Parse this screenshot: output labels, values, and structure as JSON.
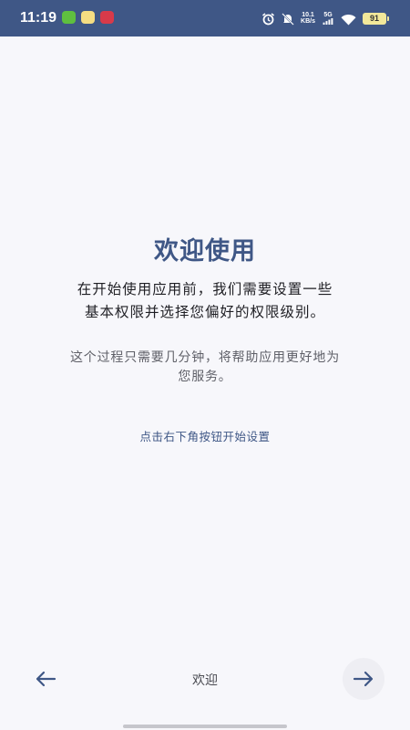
{
  "status_bar": {
    "time": "11:19",
    "net_speed_value": "10.1",
    "net_speed_unit": "KB/s",
    "network_gen": "5G",
    "battery": "91",
    "bg_color": "#3f5786",
    "app_icons": [
      "wechat-app-icon",
      "yellow-app-icon",
      "red-app-icon"
    ],
    "icons": [
      "alarm-icon",
      "mute-icon",
      "signal-icon",
      "wifi-icon",
      "battery-icon"
    ]
  },
  "main": {
    "title": "欢迎使用",
    "intro_lines": [
      "在开始使用应用前，我们需要设置一些",
      "基本权限并选择您偏好的权限级别。"
    ],
    "sub_lines": [
      "这个过程只需要几分钟，将帮助应用更好地为",
      "您服务。"
    ],
    "hint": "点击右下角按钮开始设置"
  },
  "bottom_nav": {
    "back_icon": "arrow-left-icon",
    "label": "欢迎",
    "next_icon": "arrow-right-icon"
  },
  "colors": {
    "accent": "#3f5786",
    "background": "#f7f7fb"
  }
}
